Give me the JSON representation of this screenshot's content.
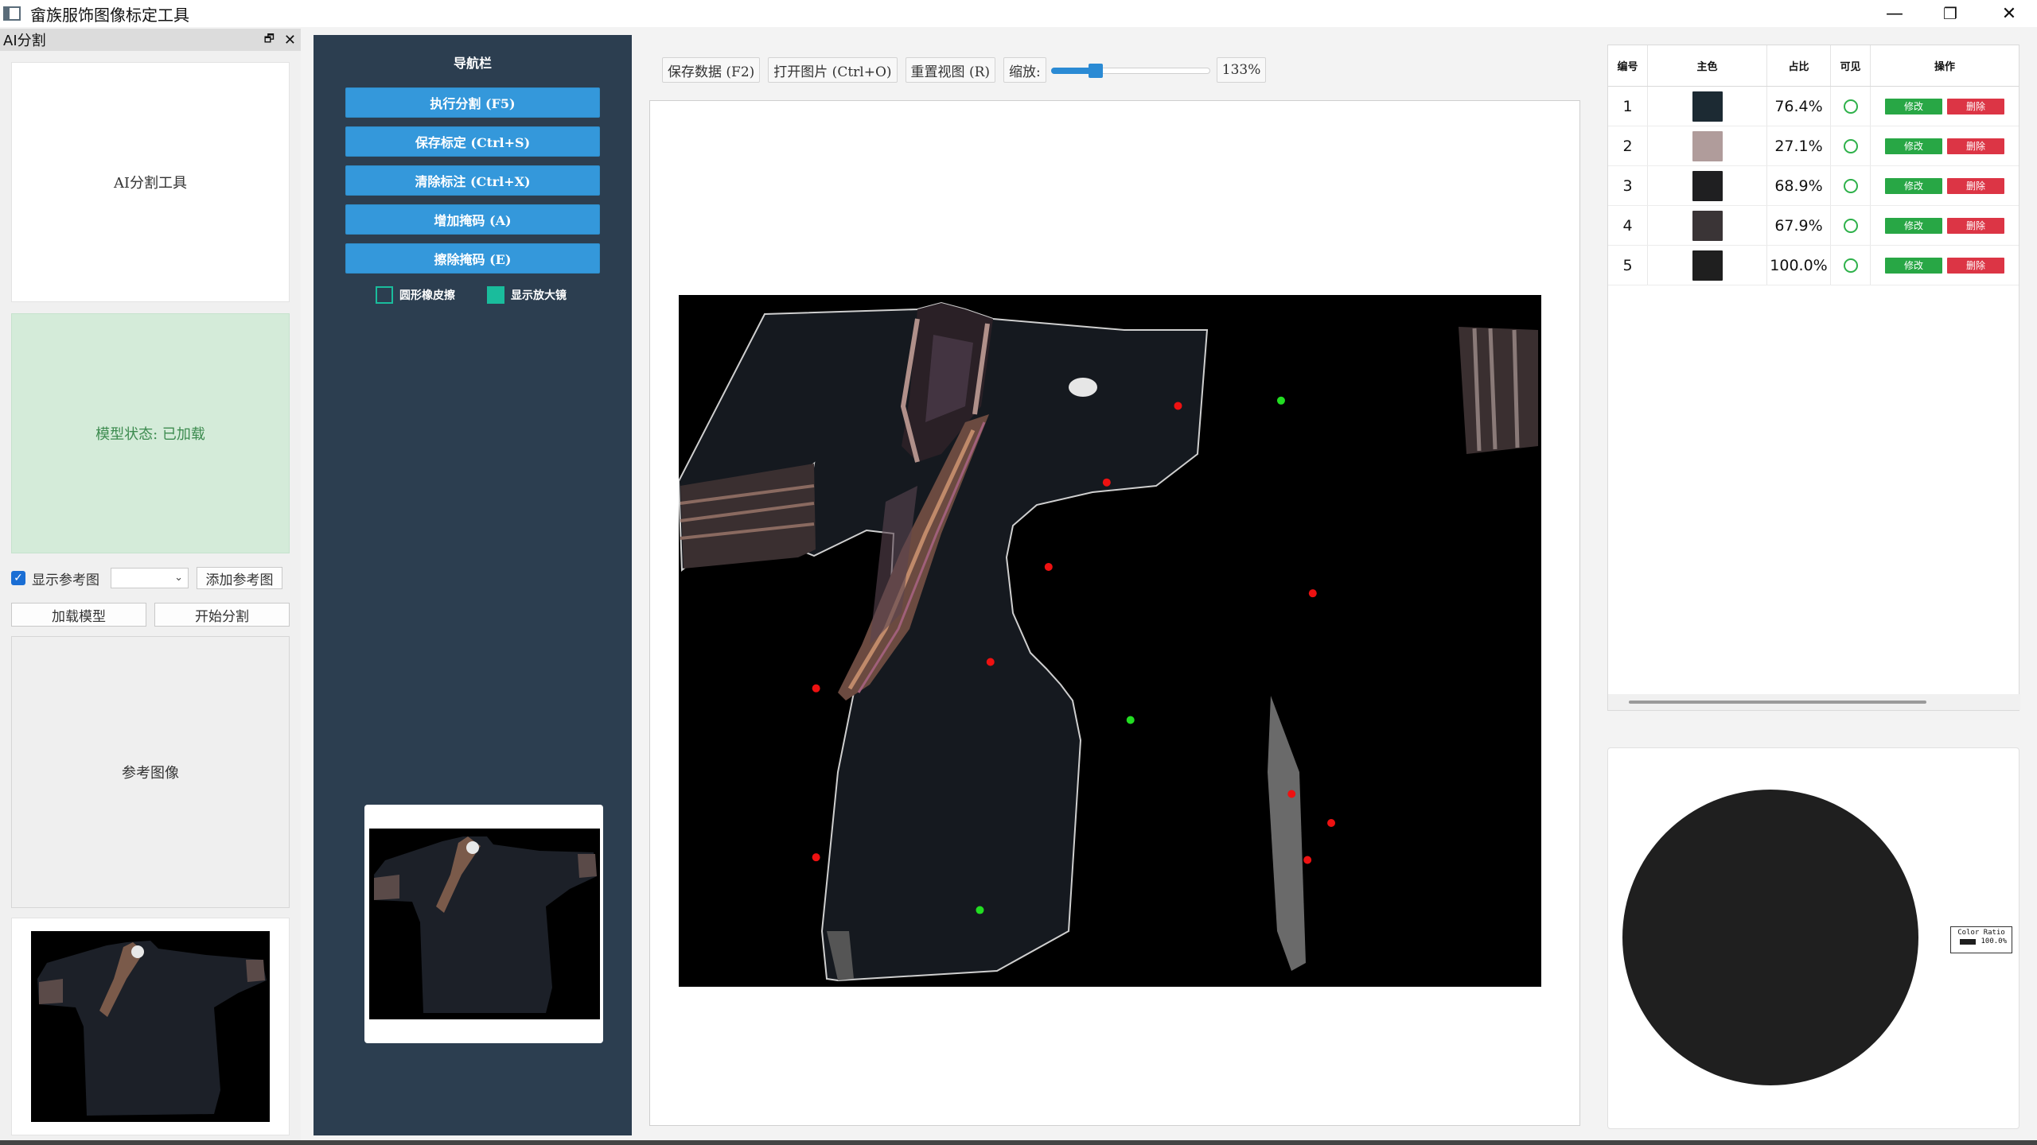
{
  "window": {
    "title": "畲族服饰图像标定工具",
    "minimize_glyph": "—",
    "restore_glyph": "❐",
    "close_glyph": "✕"
  },
  "dock": {
    "title": "AI分割",
    "float_glyph": "🗗",
    "close_glyph": "✕",
    "tool_panel_label": "AI分割工具",
    "model_status": "模型状态: 已加载",
    "show_reference_label": "显示参考图",
    "show_reference_checked": true,
    "reference_select_value": "",
    "add_reference_button": "添加参考图",
    "load_model_button": "加载模型",
    "start_segment_button": "开始分割",
    "reference_image_label": "参考图像"
  },
  "nav": {
    "title": "导航栏",
    "buttons": [
      {
        "label": "执行分割 (F5)"
      },
      {
        "label": "保存标定 (Ctrl+S)"
      },
      {
        "label": "清除标注 (Ctrl+X)"
      },
      {
        "label": "增加掩码 (A)"
      },
      {
        "label": "擦除掩码 (E)"
      }
    ],
    "checkboxes": [
      {
        "label": "圆形橡皮擦",
        "checked": false
      },
      {
        "label": "显示放大镜",
        "checked": true
      }
    ]
  },
  "toolbar": {
    "save_data": "保存数据 (F2)",
    "open_image": "打开图片 (Ctrl+O)",
    "reset_view": "重置视图 (R)",
    "zoom_label": "缩放:",
    "zoom_value": "133%",
    "zoom_fraction": 0.26
  },
  "canvas": {
    "points": [
      {
        "type": "positive",
        "color": "#22dd22"
      },
      {
        "type": "positive",
        "color": "#22dd22"
      },
      {
        "type": "positive",
        "color": "#22dd22"
      },
      {
        "type": "negative",
        "color": "#ee1111"
      },
      {
        "type": "negative",
        "color": "#ee1111"
      },
      {
        "type": "negative",
        "color": "#ee1111"
      },
      {
        "type": "negative",
        "color": "#ee1111"
      },
      {
        "type": "negative",
        "color": "#ee1111"
      },
      {
        "type": "negative",
        "color": "#ee1111"
      },
      {
        "type": "negative",
        "color": "#ee1111"
      },
      {
        "type": "negative",
        "color": "#ee1111"
      },
      {
        "type": "negative",
        "color": "#ee1111"
      },
      {
        "type": "negative",
        "color": "#ee1111"
      }
    ]
  },
  "table": {
    "headers": {
      "id": "编号",
      "main_color": "主色",
      "ratio": "占比",
      "visible": "可见",
      "actions": "操作"
    },
    "edit_label": "修改",
    "delete_label": "删除",
    "rows": [
      {
        "id": "1",
        "color": "#1c2a33",
        "ratio": "76.4%"
      },
      {
        "id": "2",
        "color": "#b09c9b",
        "ratio": "27.1%"
      },
      {
        "id": "3",
        "color": "#1f1f21",
        "ratio": "68.9%"
      },
      {
        "id": "4",
        "color": "#3a3436",
        "ratio": "67.9%"
      },
      {
        "id": "5",
        "color": "#1f1f1f",
        "ratio": "100.0%"
      }
    ]
  },
  "pie": {
    "legend_title": "Color Ratio",
    "legend_entry": "100.0%",
    "slice_color": "#1f1f1f",
    "slice_ratio": 1.0
  },
  "colors": {
    "nav_bg": "#2c3e50",
    "nav_button": "#3498db",
    "accent_teal": "#1abc9c",
    "edit_green": "#28a745",
    "delete_red": "#dc3545"
  },
  "icons": {
    "app": "app-window-icon",
    "check": "✓",
    "combo_arrow": "⌄"
  }
}
